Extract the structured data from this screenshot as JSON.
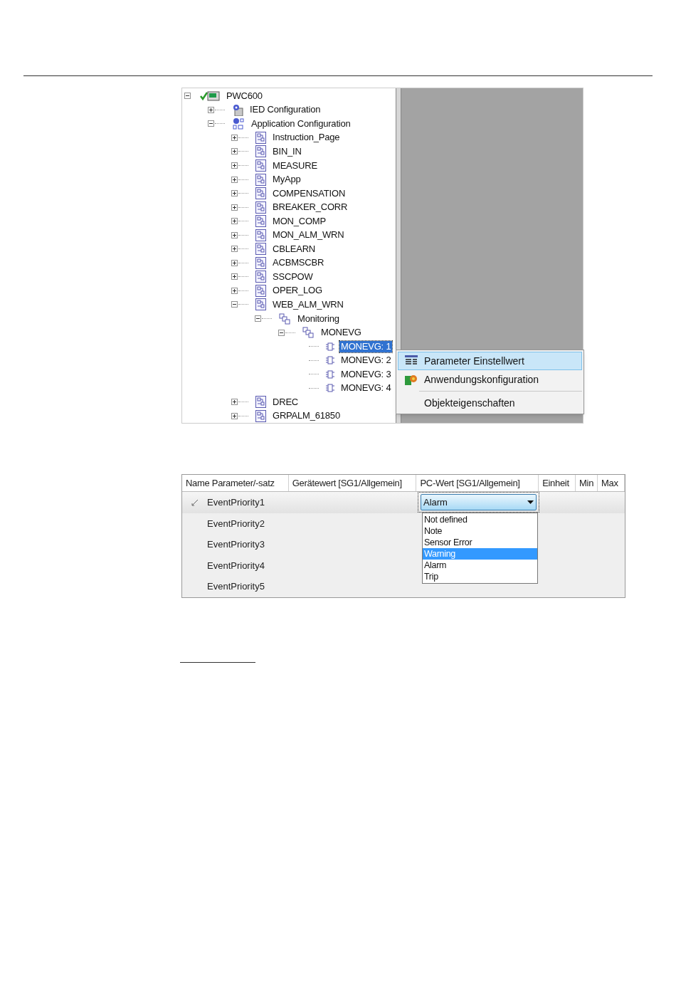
{
  "tree": {
    "items": [
      {
        "label": "PWC600",
        "kind": "device",
        "expanded": true,
        "selected": false,
        "children": [
          {
            "label": "IED Configuration",
            "kind": "ied",
            "expanded": false,
            "selected": false
          },
          {
            "label": "Application Configuration",
            "kind": "app-config",
            "expanded": true,
            "selected": false,
            "children": [
              {
                "label": "Instruction_Page",
                "kind": "page",
                "expanded": false,
                "selected": false
              },
              {
                "label": "BIN_IN",
                "kind": "page",
                "expanded": false,
                "selected": false
              },
              {
                "label": "MEASURE",
                "kind": "page",
                "expanded": false,
                "selected": false
              },
              {
                "label": "MyApp",
                "kind": "page",
                "expanded": false,
                "selected": false
              },
              {
                "label": "COMPENSATION",
                "kind": "page",
                "expanded": false,
                "selected": false
              },
              {
                "label": "BREAKER_CORR",
                "kind": "page",
                "expanded": false,
                "selected": false
              },
              {
                "label": "MON_COMP",
                "kind": "page",
                "expanded": false,
                "selected": false
              },
              {
                "label": "MON_ALM_WRN",
                "kind": "page",
                "expanded": false,
                "selected": false
              },
              {
                "label": "CBLEARN",
                "kind": "page",
                "expanded": false,
                "selected": false
              },
              {
                "label": "ACBMSCBR",
                "kind": "page",
                "expanded": false,
                "selected": false
              },
              {
                "label": "SSCPOW",
                "kind": "page",
                "expanded": false,
                "selected": false
              },
              {
                "label": "OPER_LOG",
                "kind": "page",
                "expanded": false,
                "selected": false
              },
              {
                "label": "WEB_ALM_WRN",
                "kind": "page",
                "expanded": true,
                "selected": false,
                "children": [
                  {
                    "label": "Monitoring",
                    "kind": "group",
                    "expanded": true,
                    "selected": false,
                    "children": [
                      {
                        "label": "MONEVG",
                        "kind": "group",
                        "expanded": true,
                        "selected": false,
                        "children": [
                          {
                            "label": "MONEVG: 1",
                            "kind": "function",
                            "selected": true
                          },
                          {
                            "label": "MONEVG: 2",
                            "kind": "function",
                            "selected": false
                          },
                          {
                            "label": "MONEVG: 3",
                            "kind": "function",
                            "selected": false
                          },
                          {
                            "label": "MONEVG: 4",
                            "kind": "function",
                            "selected": false
                          }
                        ]
                      }
                    ]
                  }
                ]
              },
              {
                "label": "DREC",
                "kind": "page",
                "expanded": false,
                "selected": false
              },
              {
                "label": "GRPALM_61850",
                "kind": "page",
                "expanded": false,
                "selected": false
              }
            ]
          }
        ]
      }
    ]
  },
  "context_menu": {
    "items": [
      {
        "kind": "parameters",
        "label": "Parameter Einstellwert",
        "selected": true
      },
      {
        "kind": "application",
        "label": "Anwendungskonfiguration",
        "selected": false
      },
      {
        "kind": "separator"
      },
      {
        "kind": "plain",
        "label": "Objekteigenschaften",
        "selected": false
      }
    ]
  },
  "table": {
    "columns": [
      "Name Parameter/-satz",
      "Gerätewert [SG1/Allgemein]",
      "PC-Wert [SG1/Allgemein]",
      "Einheit",
      "Min",
      "Max"
    ],
    "rows": [
      {
        "name": "EventPriority1",
        "current": true,
        "pc_value": "Alarm"
      },
      {
        "name": "EventPriority2",
        "current": false
      },
      {
        "name": "EventPriority3",
        "current": false
      },
      {
        "name": "EventPriority4",
        "current": false
      },
      {
        "name": "EventPriority5",
        "current": false
      }
    ],
    "dropdown": {
      "options": [
        {
          "label": "Not defined",
          "selected": false
        },
        {
          "label": "Note",
          "selected": false
        },
        {
          "label": "Sensor Error",
          "selected": false
        },
        {
          "label": "Warning",
          "selected": true
        },
        {
          "label": "Alarm",
          "selected": false
        },
        {
          "label": "Trip",
          "selected": false
        }
      ]
    }
  }
}
